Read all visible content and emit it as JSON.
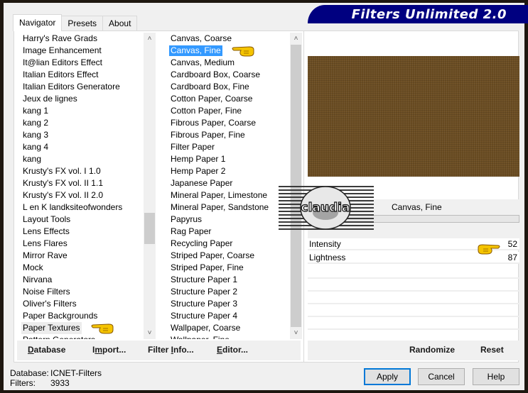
{
  "app": {
    "title": "Filters Unlimited 2.0"
  },
  "tabs": [
    {
      "label": "Navigator",
      "active": true
    },
    {
      "label": "Presets",
      "active": false
    },
    {
      "label": "About",
      "active": false
    }
  ],
  "categories": {
    "items": [
      "Harry's Rave Grads",
      "Image Enhancement",
      "It@lian Editors Effect",
      "Italian Editors Effect",
      "Italian Editors Generatore",
      "Jeux de lignes",
      "kang 1",
      "kang 2",
      "kang 3",
      "kang 4",
      "kang",
      "Krusty's FX vol. I 1.0",
      "Krusty's FX vol. II 1.1",
      "Krusty's FX vol. II 2.0",
      "L en K landksiteofwonders",
      "Layout Tools",
      "Lens Effects",
      "Lens Flares",
      "Mirror Rave",
      "Mock",
      "Nirvana",
      "Noise Filters",
      "Oliver's Filters",
      "Paper Backgrounds",
      "Paper Textures",
      "Pattern Generators"
    ],
    "selected": "Paper Textures"
  },
  "filters": {
    "items": [
      "Canvas, Coarse",
      "Canvas, Fine",
      "Canvas, Medium",
      "Cardboard Box, Coarse",
      "Cardboard Box, Fine",
      "Cotton Paper, Coarse",
      "Cotton Paper, Fine",
      "Fibrous Paper, Coarse",
      "Fibrous Paper, Fine",
      "Filter Paper",
      "Hemp Paper 1",
      "Hemp Paper 2",
      "Japanese Paper",
      "Mineral Paper, Limestone",
      "Mineral Paper, Sandstone",
      "Papyrus",
      "Rag Paper",
      "Recycling Paper",
      "Striped Paper, Coarse",
      "Striped Paper, Fine",
      "Structure Paper 1",
      "Structure Paper 2",
      "Structure Paper 3",
      "Structure Paper 4",
      "Wallpaper, Coarse",
      "Wallpaper, Fine"
    ],
    "selected": "Canvas, Fine"
  },
  "nav_toolbar": {
    "database": {
      "label_pre": "",
      "accel": "D",
      "label_post": "atabase"
    },
    "import": {
      "label_pre": "I",
      "accel": "m",
      "label_post": "port..."
    },
    "filter_info": {
      "label_pre": "Filter ",
      "accel": "I",
      "label_post": "nfo..."
    },
    "editor": {
      "label_pre": "",
      "accel": "E",
      "label_post": "ditor..."
    }
  },
  "preview": {
    "filter_name": "Canvas, Fine",
    "color": "#6b4d22"
  },
  "params": [
    {
      "label": "Intensity",
      "value": "52"
    },
    {
      "label": "Lightness",
      "value": "87"
    }
  ],
  "right_toolbar": {
    "randomize": "Randomize",
    "reset": "Reset"
  },
  "status": {
    "database_label": "Database:",
    "database_value": "ICNET-Filters",
    "filters_label": "Filters:",
    "filters_value": "3933"
  },
  "buttons": {
    "apply": "Apply",
    "cancel": "Cancel",
    "help": "Help"
  },
  "watermark": {
    "text": "claudia"
  },
  "colors": {
    "banner": "#000080",
    "selection": "#3399ff",
    "default_button_border": "#0078d7"
  }
}
